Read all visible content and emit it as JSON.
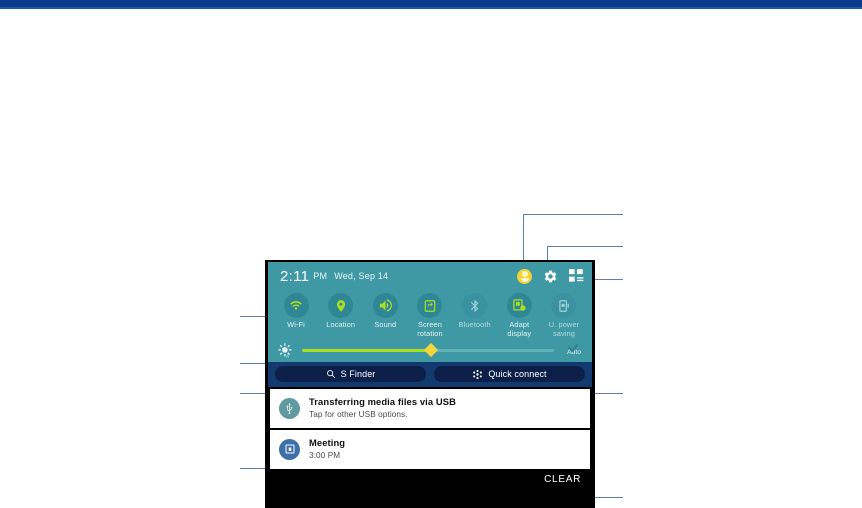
{
  "page": {
    "background_color": "#ffffff",
    "topbar_color": "#0b3c8c"
  },
  "panel": {
    "status": {
      "time": "2:11",
      "meridiem": "PM",
      "date": "Wed, Sep 14",
      "icons": [
        {
          "name": "user-profile-icon",
          "label": "User"
        },
        {
          "name": "gear-icon",
          "label": "Settings"
        },
        {
          "name": "edit-quick-settings-icon",
          "label": "Edit quick settings"
        }
      ]
    },
    "quick_toggles": [
      {
        "label": "Wi-Fi",
        "icon": "wifi-icon",
        "state": "on"
      },
      {
        "label": "Location",
        "icon": "location-pin-icon",
        "state": "on"
      },
      {
        "label": "Sound",
        "icon": "sound-speaker-icon",
        "state": "on"
      },
      {
        "label": "Screen rotation",
        "icon": "screen-rotation-icon",
        "state": "on"
      },
      {
        "label": "Bluetooth",
        "icon": "bluetooth-icon",
        "state": "off"
      },
      {
        "label": "Adapt display",
        "icon": "adapt-display-icon",
        "state": "on"
      },
      {
        "label": "U. power saving",
        "icon": "ultra-power-saving-icon",
        "state": "off"
      }
    ],
    "brightness": {
      "icon": "brightness-sun-icon",
      "value_percent": 51,
      "auto_label": "Auto",
      "auto_checked": true
    },
    "actions": [
      {
        "label": "S Finder",
        "icon": "search-icon"
      },
      {
        "label": "Quick connect",
        "icon": "quick-connect-icon"
      }
    ],
    "notifications": [
      {
        "icon": "usb-icon",
        "title": "Transferring media files via USB",
        "subtitle": "Tap for other USB options."
      },
      {
        "icon": "calendar-icon",
        "title": "Meeting",
        "subtitle": "3:00 PM"
      }
    ],
    "clear_label": "CLEAR"
  },
  "colors": {
    "quick_settings_bg": "#3e99a4",
    "toggle_circle": "#2f8795",
    "toggle_icon_on": "#a8e021",
    "finder_bar_bg": "#123a6e",
    "pill_bg": "#0c1f48",
    "slider_fill": "#a8e021",
    "slider_knob": "#f3d63c",
    "panel_border": "#000000"
  },
  "callouts": {
    "left": [
      "quick-toggles",
      "brightness-slider",
      "s-finder",
      "notifications"
    ],
    "right": [
      "user-profile",
      "settings-gear",
      "edit-quick-settings",
      "quick-connect",
      "clear"
    ]
  }
}
